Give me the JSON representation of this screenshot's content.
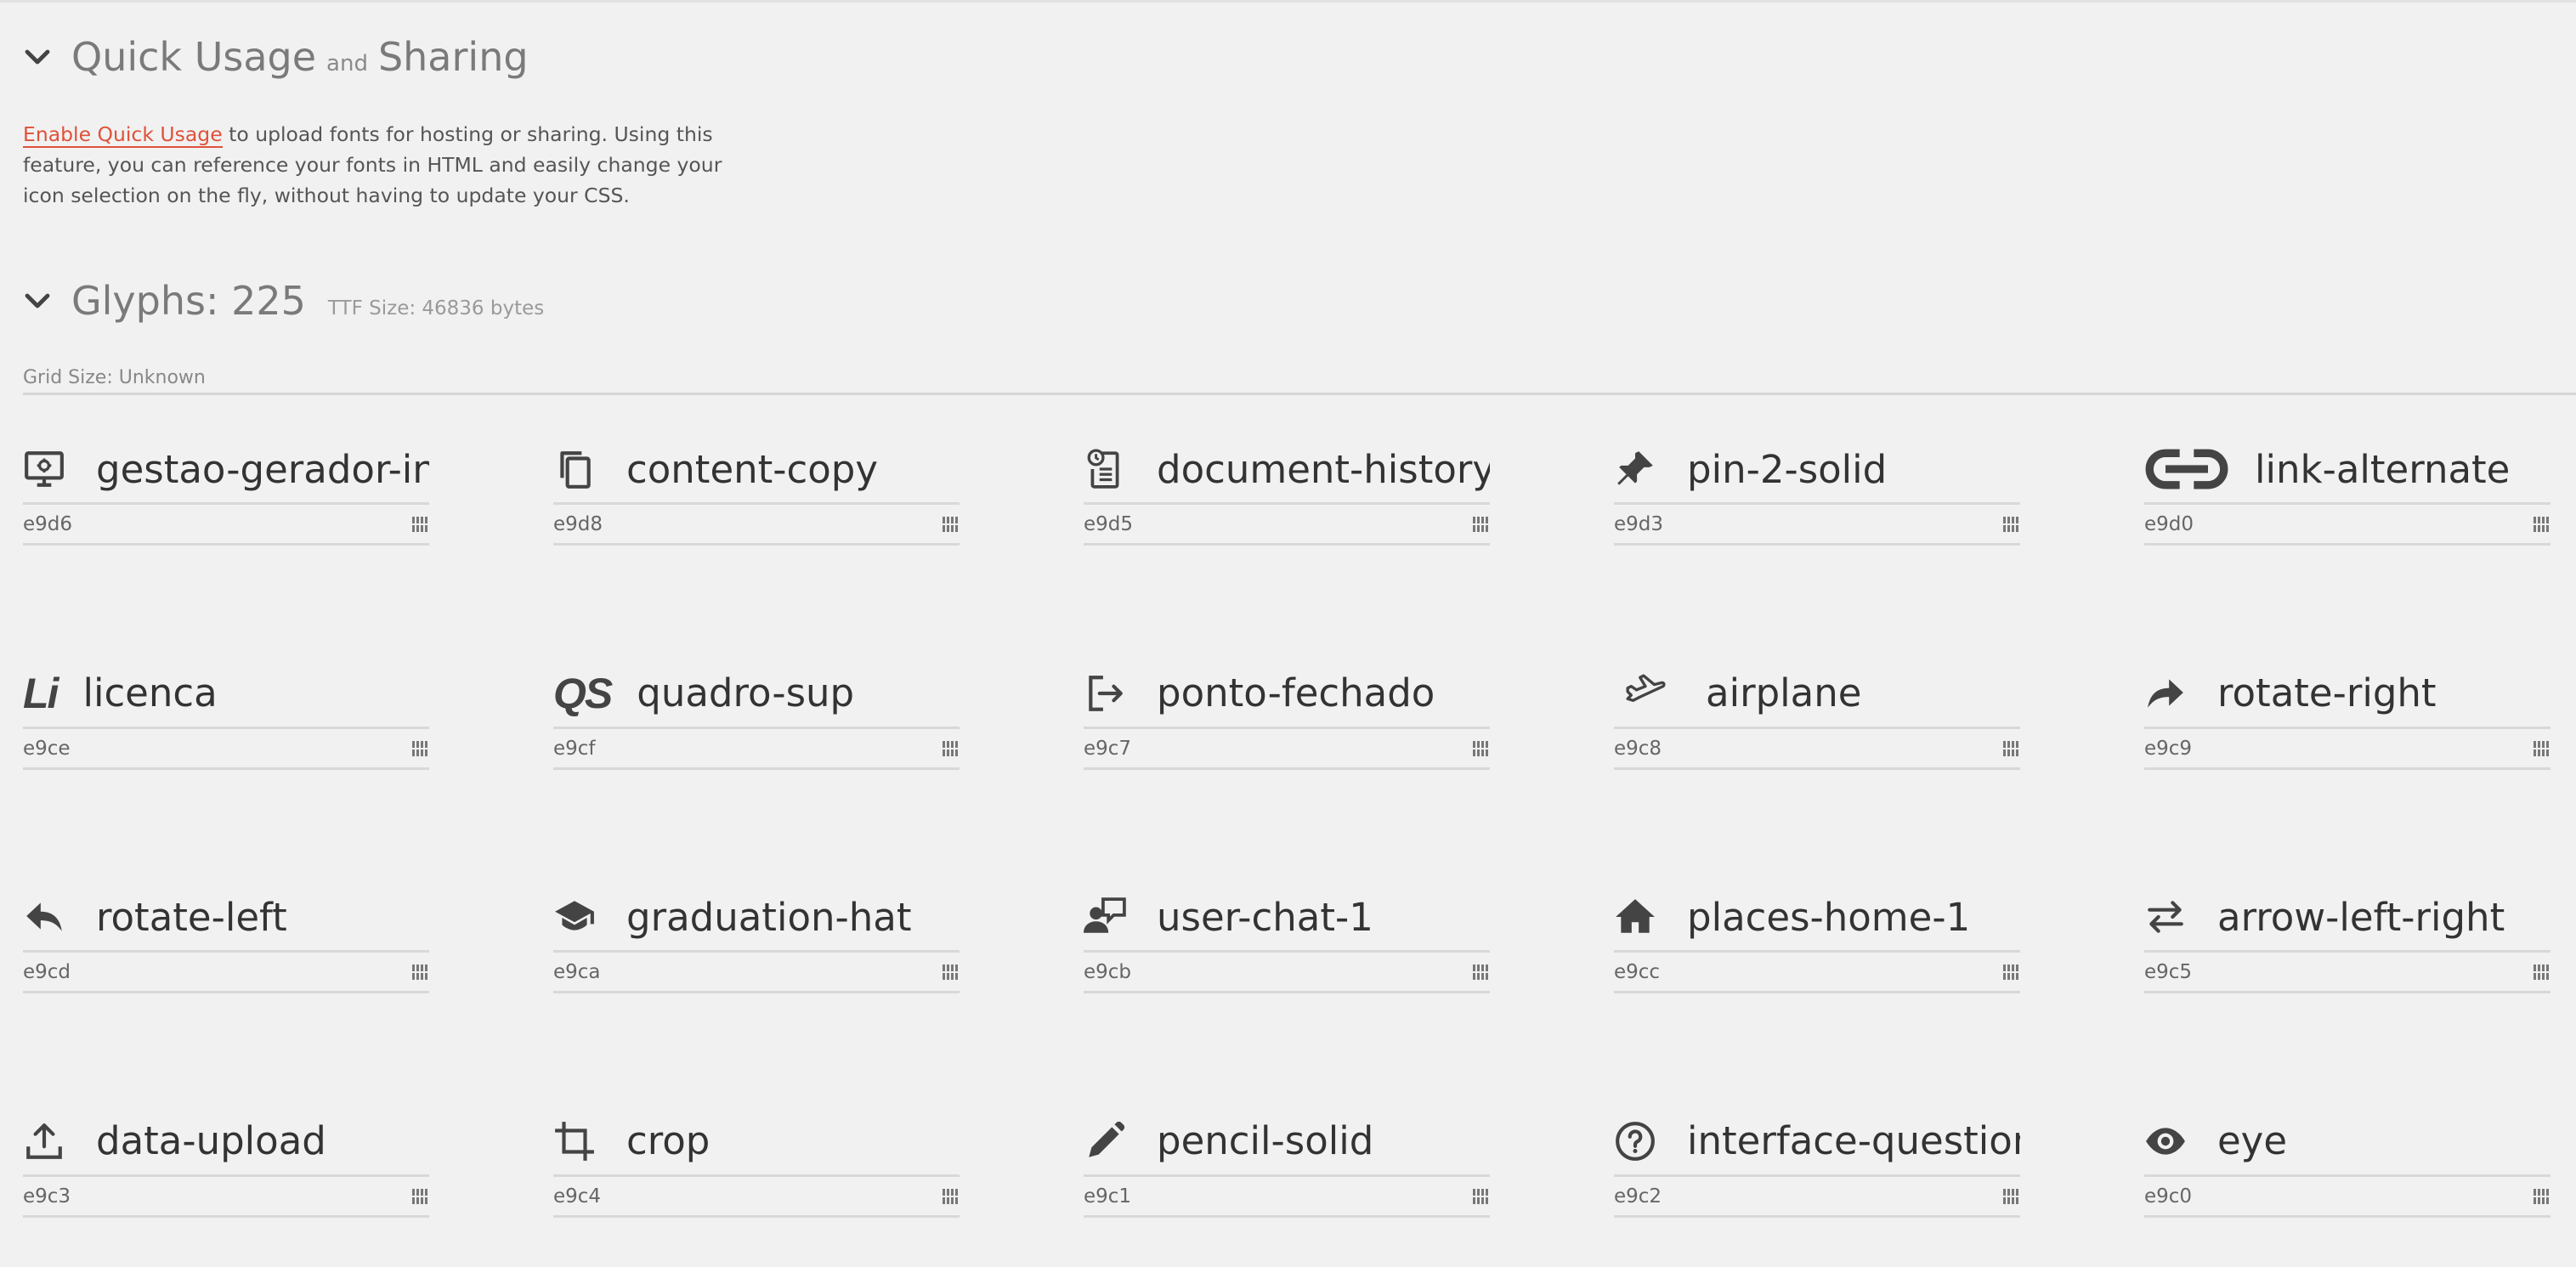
{
  "quick": {
    "title_a": "Quick Usage",
    "title_and": "and",
    "title_b": "Sharing",
    "link": "Enable Quick Usage",
    "text": " to upload fonts for hosting or sharing. Using this feature, you can reference your fonts in HTML and easily change your icon selection on the fly, without having to update your CSS."
  },
  "glyphs": {
    "title": "Glyphs: 225",
    "ttf_size": "TTF Size: 46836 bytes",
    "grid_size": "Grid Size: Unknown",
    "items": [
      {
        "name": "gestao-gerador-int",
        "code": "e9d6",
        "icon": "monitor-icon"
      },
      {
        "name": "content-copy",
        "code": "e9d8",
        "icon": "copy-icon"
      },
      {
        "name": "document-history",
        "code": "e9d5",
        "icon": "document-history-icon"
      },
      {
        "name": "pin-2-solid",
        "code": "e9d3",
        "icon": "pin-icon"
      },
      {
        "name": "link-alternate",
        "code": "e9d0",
        "icon": "link-icon"
      },
      {
        "name": "licenca",
        "code": "e9ce",
        "icon": "li-text-icon",
        "icon_text": "Li"
      },
      {
        "name": "quadro-sup",
        "code": "e9cf",
        "icon": "qs-text-icon",
        "icon_text": "QS"
      },
      {
        "name": "ponto-fechado",
        "code": "e9c7",
        "icon": "logout-icon"
      },
      {
        "name": "airplane",
        "code": "e9c8",
        "icon": "airplane-icon"
      },
      {
        "name": "rotate-right",
        "code": "e9c9",
        "icon": "rotate-right-icon"
      },
      {
        "name": "rotate-left",
        "code": "e9cd",
        "icon": "rotate-left-icon"
      },
      {
        "name": "graduation-hat",
        "code": "e9ca",
        "icon": "graduation-hat-icon"
      },
      {
        "name": "user-chat-1",
        "code": "e9cb",
        "icon": "user-chat-icon"
      },
      {
        "name": "places-home-1",
        "code": "e9cc",
        "icon": "home-icon"
      },
      {
        "name": "arrow-left-right",
        "code": "e9c5",
        "icon": "arrow-left-right-icon"
      },
      {
        "name": "data-upload",
        "code": "e9c3",
        "icon": "upload-icon"
      },
      {
        "name": "crop",
        "code": "e9c4",
        "icon": "crop-icon"
      },
      {
        "name": "pencil-solid",
        "code": "e9c1",
        "icon": "pencil-icon"
      },
      {
        "name": "interface-question-",
        "code": "e9c2",
        "icon": "question-circle-icon"
      },
      {
        "name": "eye",
        "code": "e9c0",
        "icon": "eye-icon"
      }
    ]
  }
}
